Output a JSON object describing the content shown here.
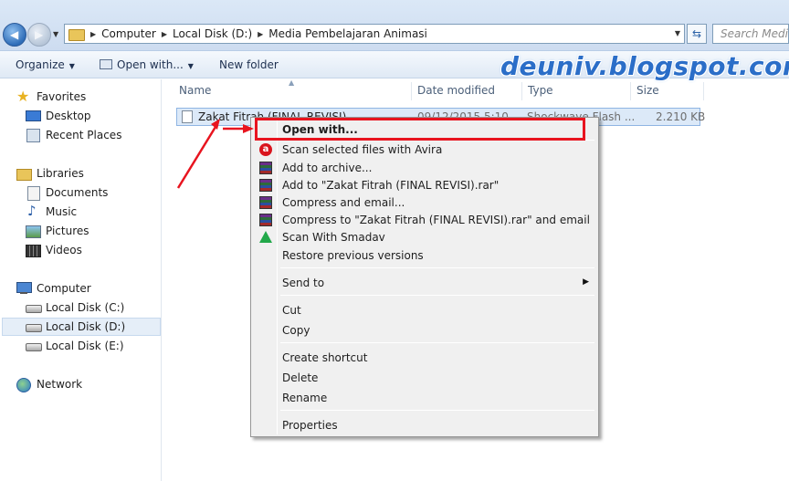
{
  "address_bar": {
    "path": [
      "Computer",
      "Local Disk (D:)",
      "Media Pembelajaran Animasi"
    ],
    "search_placeholder": "Search Media Pembelajaran Animasi"
  },
  "toolbar": {
    "organize": "Organize",
    "open_with": "Open with...",
    "new_folder": "New folder"
  },
  "watermark": "deuniv.blogspot.com",
  "nav": {
    "favorites": "Favorites",
    "desktop": "Desktop",
    "recent_places": "Recent Places",
    "libraries": "Libraries",
    "documents": "Documents",
    "music": "Music",
    "pictures": "Pictures",
    "videos": "Videos",
    "computer": "Computer",
    "disk_c": "Local Disk (C:)",
    "disk_d": "Local Disk (D:)",
    "disk_e": "Local Disk (E:)",
    "network": "Network"
  },
  "columns": {
    "name": "Name",
    "date_modified": "Date modified",
    "type": "Type",
    "size": "Size"
  },
  "file": {
    "name": "Zakat Fitrah (FINAL REVISI)",
    "date": "09/12/2015 5:10",
    "type": "Shockwave Flash ...",
    "size": "2.210 KB"
  },
  "context_menu": {
    "open_with": "Open with...",
    "scan_avira": "Scan selected files with Avira",
    "add_archive": "Add to archive...",
    "add_to_rar": "Add to \"Zakat Fitrah (FINAL REVISI).rar\"",
    "compress_email": "Compress and email...",
    "compress_to_rar_email": "Compress to \"Zakat Fitrah (FINAL REVISI).rar\" and email",
    "scan_smadav": "Scan With Smadav",
    "restore": "Restore previous versions",
    "send_to": "Send to",
    "cut": "Cut",
    "copy": "Copy",
    "create_shortcut": "Create shortcut",
    "delete": "Delete",
    "rename": "Rename",
    "properties": "Properties"
  },
  "colors": {
    "highlight_red": "#e8141f",
    "watermark_blue": "#2b6ec8",
    "selection_blue": "#dce9f8"
  }
}
